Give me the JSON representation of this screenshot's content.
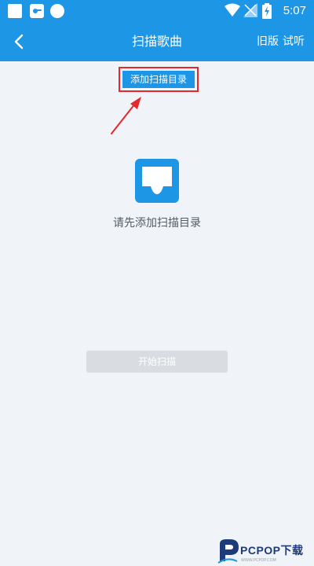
{
  "status_bar": {
    "time": "5:07"
  },
  "header": {
    "title": "扫描歌曲",
    "action_old_version": "旧版",
    "action_listen": "试听",
    "background": "#1e96e6"
  },
  "main": {
    "add_directory_label": "添加扫描目录",
    "empty_message": "请先添加扫描目录",
    "start_scan_label": "开始扫描",
    "highlight_color": "#e8262b"
  },
  "watermark": {
    "brand": "PCPOP下载",
    "sub": "WWW.PCPOP.COM"
  }
}
